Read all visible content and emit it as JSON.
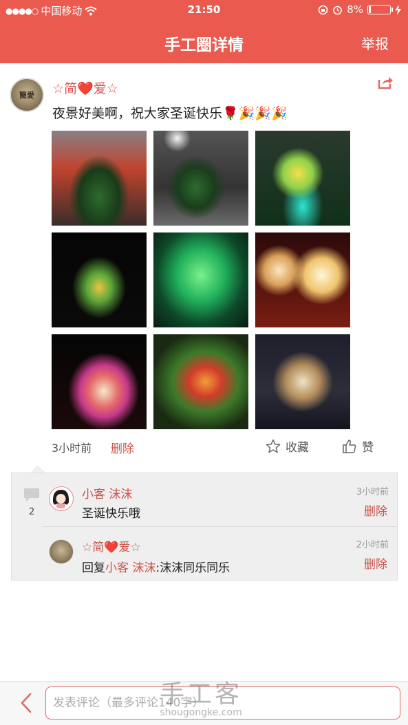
{
  "status_bar": {
    "carrier": "中国移动",
    "time": "21:50",
    "battery": "8%"
  },
  "nav": {
    "title": "手工圈详情",
    "report_label": "举报"
  },
  "post": {
    "author": "☆简❤️爱☆",
    "avatar_text": "簡愛",
    "text": "夜景好美啊，祝大家圣诞快乐",
    "emojis": "🌹🎉🎉🎉",
    "photo_count": 9,
    "time": "3小时前",
    "delete_label": "删除",
    "collect_label": "收藏",
    "like_label": "赞",
    "share_icon": "share-icon"
  },
  "comments": {
    "count": "2",
    "items": [
      {
        "name": "小客 沫沫",
        "text": "圣诞快乐哦",
        "time": "3小时前",
        "delete_label": "删除"
      },
      {
        "name": "☆简❤️爱☆",
        "reply_prefix": "回复",
        "reply_to": "小客 沫沫",
        "reply_text": ":沫沫同乐同乐",
        "time": "2小时前",
        "delete_label": "删除"
      }
    ]
  },
  "bottom": {
    "input_placeholder": "发表评论（最多评论140字）",
    "watermark_big": "手工客",
    "watermark_small": "shougongke.com"
  },
  "colors": {
    "brand": "#ea5a4e",
    "link": "#c9534a"
  }
}
